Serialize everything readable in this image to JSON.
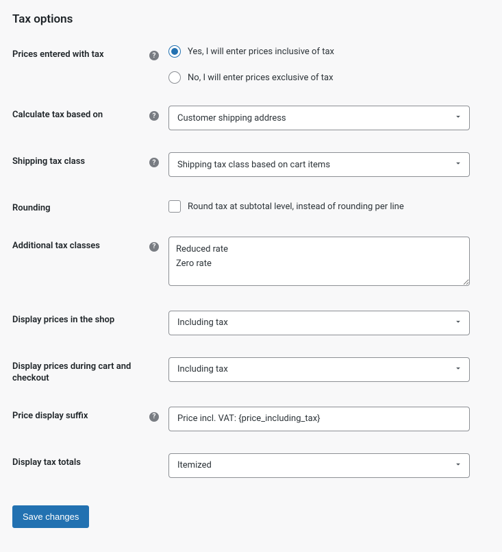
{
  "title": "Tax options",
  "rows": {
    "prices_tax": {
      "label": "Prices entered with tax",
      "option_yes": "Yes, I will enter prices inclusive of tax",
      "option_no": "No, I will enter prices exclusive of tax"
    },
    "calc_based": {
      "label": "Calculate tax based on",
      "value": "Customer shipping address"
    },
    "shipping_class": {
      "label": "Shipping tax class",
      "value": "Shipping tax class based on cart items"
    },
    "rounding": {
      "label": "Rounding",
      "option": "Round tax at subtotal level, instead of rounding per line"
    },
    "additional_classes": {
      "label": "Additional tax classes",
      "value": "Reduced rate\nZero rate"
    },
    "display_shop": {
      "label": "Display prices in the shop",
      "value": "Including tax"
    },
    "display_cart": {
      "label": "Display prices during cart and checkout",
      "value": "Including tax"
    },
    "price_suffix": {
      "label": "Price display suffix",
      "value": "Price incl. VAT: {price_including_tax}"
    },
    "display_totals": {
      "label": "Display tax totals",
      "value": "Itemized"
    }
  },
  "save_label": "Save changes"
}
